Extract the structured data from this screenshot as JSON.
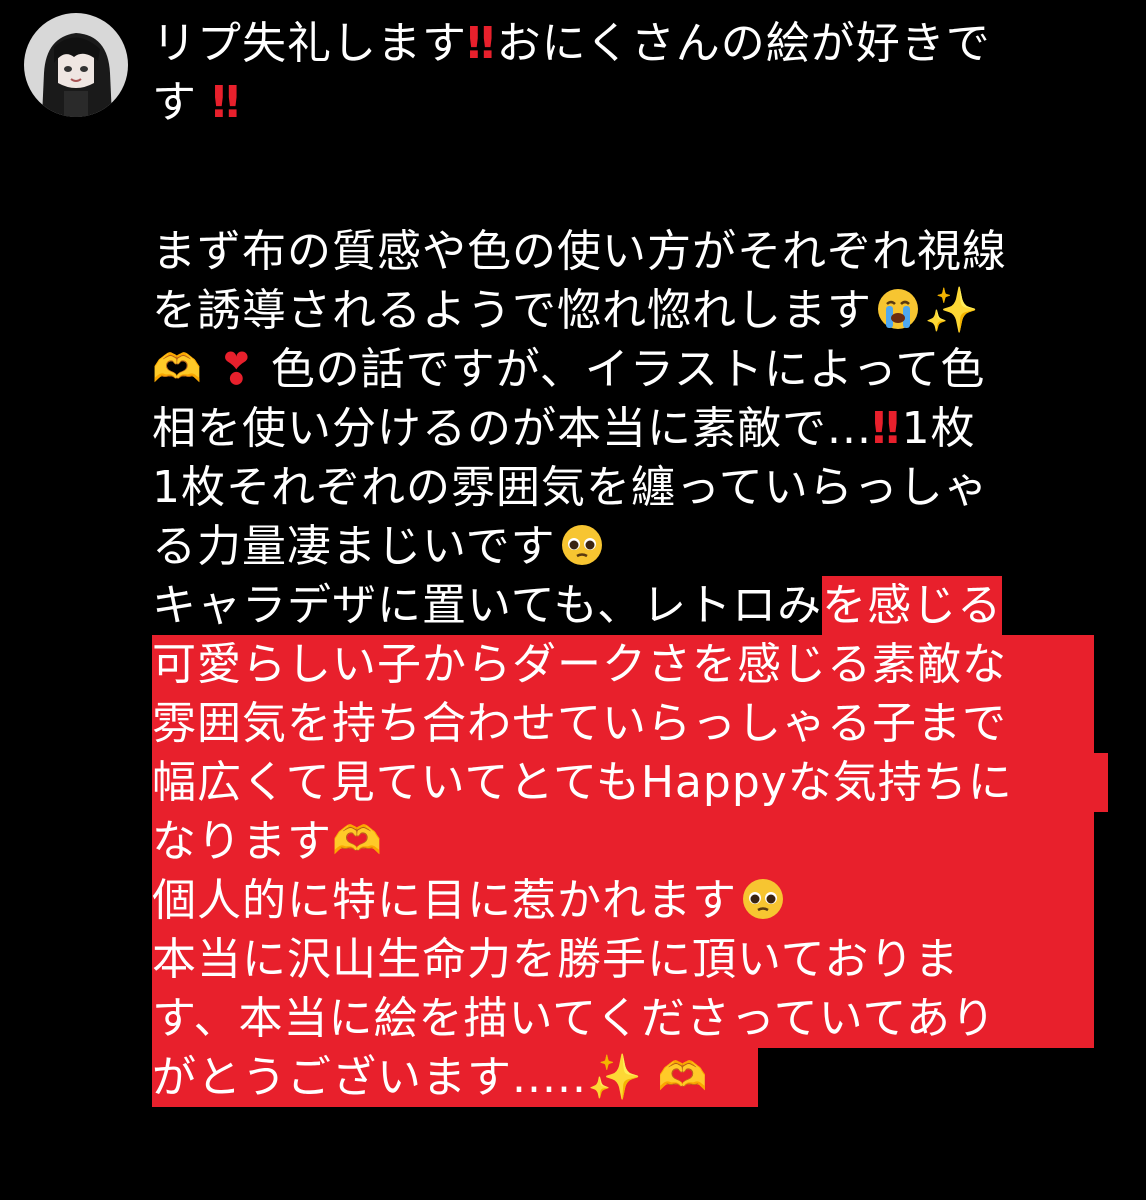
{
  "reply": {
    "avatar_icon": "user-avatar-icon",
    "lines": {
      "l1a": "リプ失礼します",
      "l1b": "おにくさんの絵が好きで",
      "l2a": "す",
      "l3": "まず布の質感や色の使い方がそれぞれ視線",
      "l4": "を誘導されるようで惚れ惚れします",
      "l5": "色の話ですが、イラストによって色",
      "l6a": "相を使い分けるのが本当に素敵で...",
      "l6b": "1枚",
      "l7": "1枚それぞれの雰囲気を纏っていらっしゃ",
      "l8": "る力量凄まじいです",
      "l9a": "キャラデザに置いても、レトロみ",
      "l9b": "を感じる",
      "l10": "可愛らしい子からダークさを感じる素敵な",
      "l11": "雰囲気を持ち合わせていらっしゃる子まで",
      "l12": "幅広くて見ていてとてもHappyな気持ちに",
      "l13": "なります",
      "l14": "個人的に特に目に惹かれます",
      "l15": "本当に沢山生命力を勝手に頂いておりま",
      "l16": "す、本当に絵を描いてくださっていてあり",
      "l17": "がとうございます....."
    },
    "emoji": {
      "double_bang": "‼",
      "sparkles": "✨",
      "heart": "❣",
      "heart_hands": "🫶",
      "crying_face": "crying-face-icon",
      "pleading_face": "pleading-face-icon"
    },
    "colors": {
      "background": "#000000",
      "text": "#ffffff",
      "highlight": "#e8202c"
    }
  }
}
